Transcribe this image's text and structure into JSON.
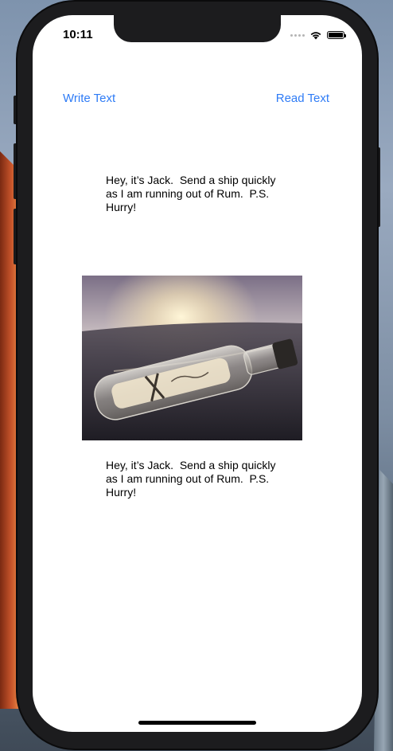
{
  "status_bar": {
    "time": "10:11"
  },
  "nav": {
    "left_button": "Write Text",
    "right_button": "Read Text"
  },
  "content": {
    "message_top": "Hey, it’s Jack.  Send a ship quickly\nas I am running out of Rum.  P.S.\nHurry!",
    "message_bottom": "Hey, it’s Jack.  Send a ship quickly\nas I am running out of Rum.  P.S.\nHurry!",
    "image_subject": "message-in-a-bottle-on-beach"
  },
  "colors": {
    "accent": "#2f7cf6",
    "text": "#000000",
    "background": "#ffffff"
  }
}
